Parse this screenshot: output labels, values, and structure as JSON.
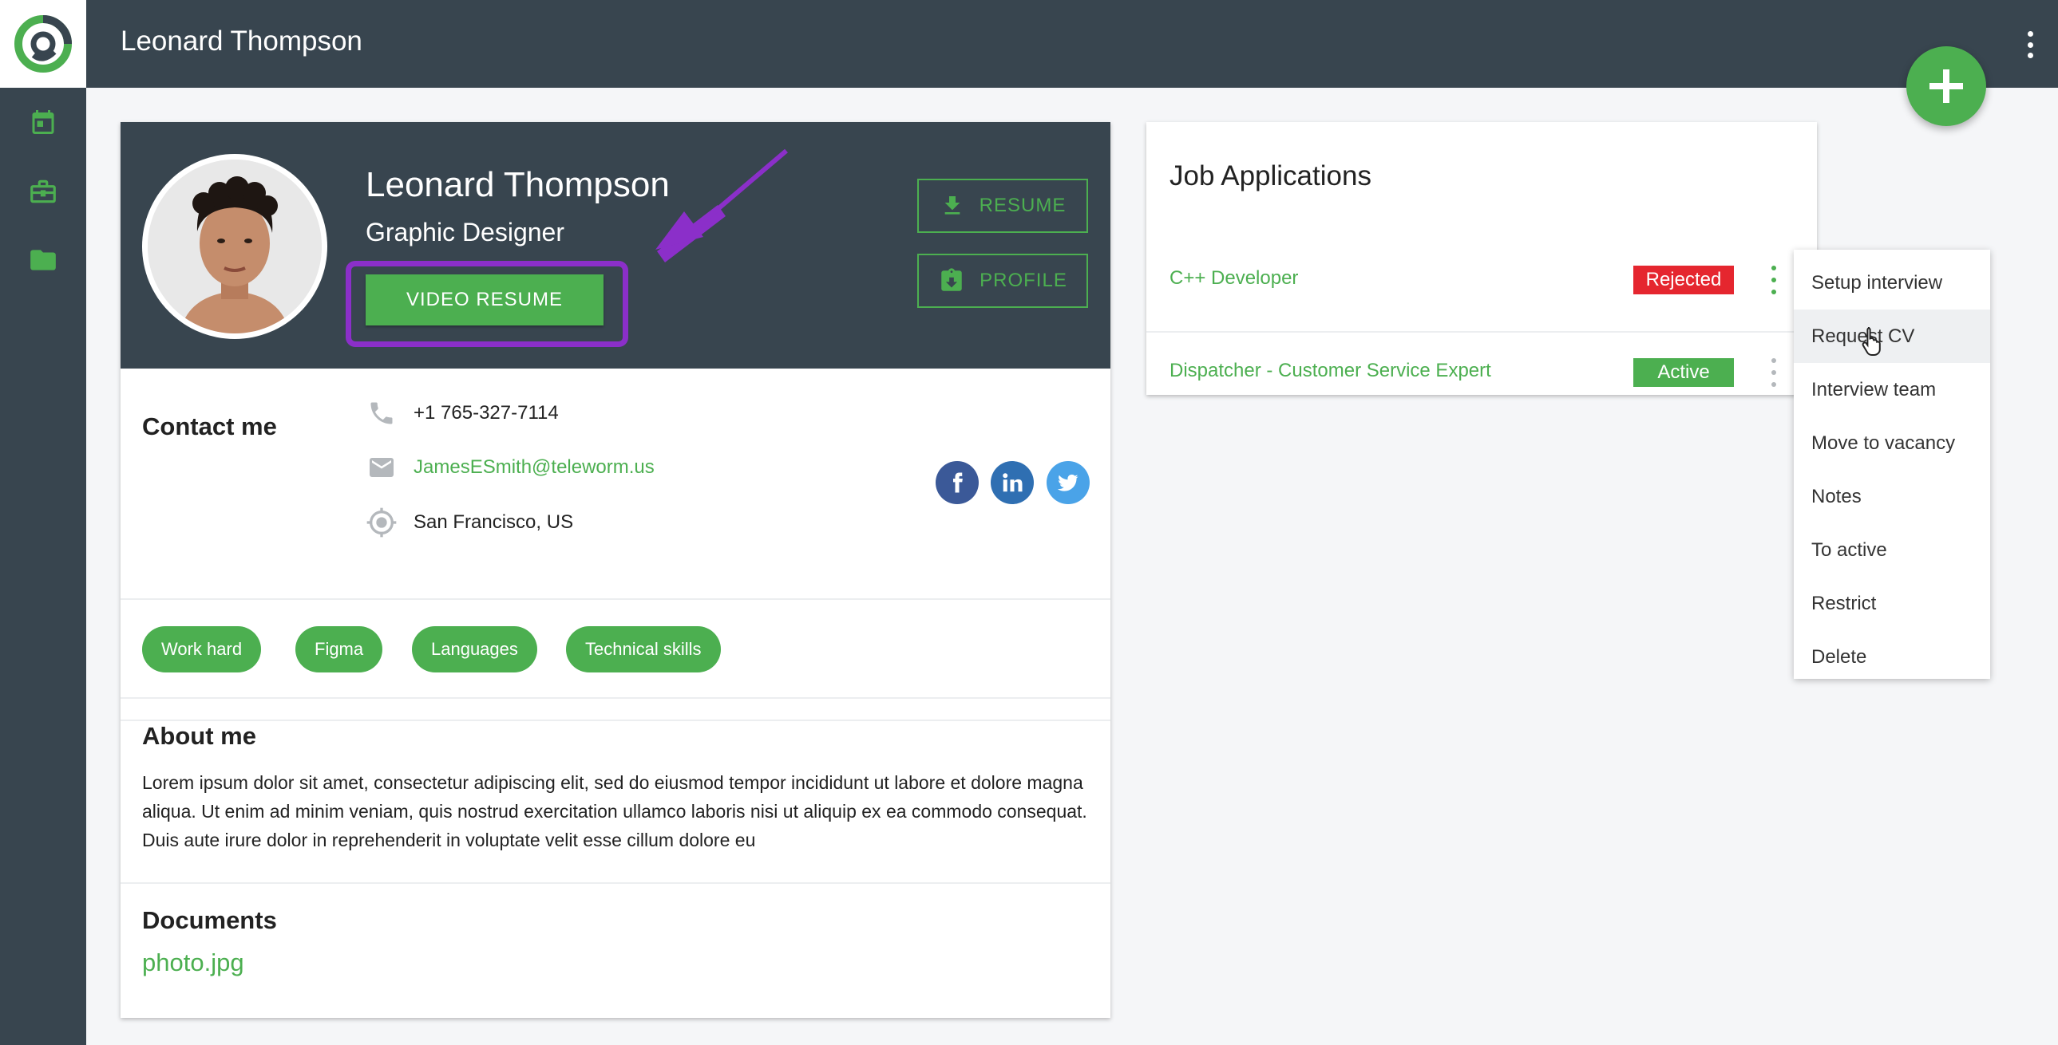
{
  "header": {
    "title": "Leonard Thompson"
  },
  "sidebar": {
    "icons": [
      "logo-icon",
      "calendar-icon",
      "briefcase-icon",
      "folder-icon"
    ]
  },
  "profile": {
    "name": "Leonard Thompson",
    "role": "Graphic Designer",
    "video_resume_label": "VIDEO RESUME",
    "resume_label": "RESUME",
    "profile_label": "PROFILE"
  },
  "contact": {
    "title": "Contact me",
    "phone": "+1 765-327-7114",
    "email": "JamesESmith@teleworm.us",
    "location": "San Francisco, US"
  },
  "tags": [
    "Work hard",
    "Figma",
    "Languages",
    "Technical skills"
  ],
  "about": {
    "title": "About me",
    "text": "Lorem ipsum dolor sit amet, consectetur adipiscing elit, sed do eiusmod tempor incididunt ut labore et dolore magna aliqua. Ut enim ad minim veniam, quis nostrud exercitation ullamco laboris nisi ut aliquip ex ea commodo consequat. Duis aute irure dolor in reprehenderit in voluptate velit esse cillum dolore eu"
  },
  "documents": {
    "title": "Documents",
    "files": [
      "photo.jpg"
    ]
  },
  "jobs": {
    "title": "Job Applications",
    "items": [
      {
        "title": "C++ Developer",
        "status": "Rejected",
        "status_color": "#e5262f"
      },
      {
        "title": "Dispatcher - Customer Service Expert",
        "status": "Active",
        "status_color": "#4caf50"
      }
    ]
  },
  "menu": {
    "items": [
      "Setup interview",
      "Request CV",
      "Interview team",
      "Move to vacancy",
      "Notes",
      "To active",
      "Restrict",
      "Delete"
    ],
    "hovered": "Request CV"
  },
  "colors": {
    "accent": "#4caf50",
    "dark": "#38454f",
    "highlight": "#8b2fc9",
    "danger": "#e5262f"
  }
}
